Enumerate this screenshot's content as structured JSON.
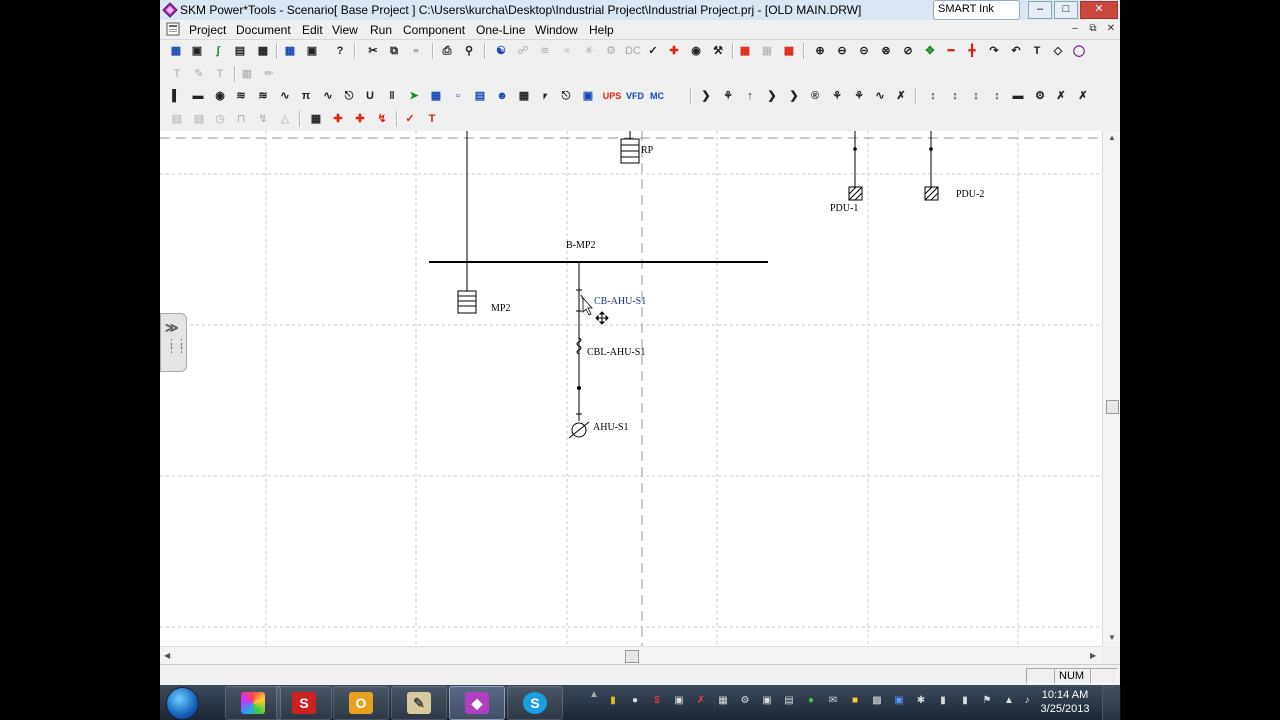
{
  "window": {
    "title": "SKM Power*Tools - Scenario[ Base Project ] C:\\Users\\kurcha\\Desktop\\Industrial Project\\Industrial Project.prj - [OLD MAIN.DRW]",
    "smart_ink_label": "SMART Ink",
    "minimize": "–",
    "maximize": "□",
    "close": "✕"
  },
  "menu": {
    "items": [
      "Project",
      "Document",
      "Edit",
      "View",
      "Run",
      "Component",
      "One-Line",
      "Window",
      "Help"
    ]
  },
  "one_line": {
    "buses": [
      {
        "id": "bus-b-mp2",
        "label": "B-MP2"
      }
    ],
    "components": [
      {
        "id": "panel-rp",
        "label": "RP",
        "type": "panel"
      },
      {
        "id": "pdu-1",
        "label": "PDU-1",
        "type": "pdu"
      },
      {
        "id": "pdu-2",
        "label": "PDU-2",
        "type": "pdu"
      },
      {
        "id": "panel-mp2",
        "label": "MP2",
        "type": "panel"
      },
      {
        "id": "breaker-cb-ahu-s1",
        "label": "CB-AHU-S1",
        "type": "breaker"
      },
      {
        "id": "cable-cbl-ahu-s1",
        "label": "CBL-AHU-S1",
        "type": "cable"
      },
      {
        "id": "motor-ahu-s1",
        "label": "AHU-S1",
        "type": "motor"
      }
    ]
  },
  "status": {
    "num": "NUM"
  },
  "taskbar": {
    "apps": [
      "internet-explorer",
      "color-app",
      "skm-app",
      "outlook",
      "notepad-app",
      "smart-notebook",
      "skype"
    ],
    "clock_time": "10:14 AM",
    "clock_date": "3/25/2013"
  },
  "colors": {
    "titlebar": "#dbe6f3",
    "canvas": "#ffffff",
    "grid_line": "#c8c8c8",
    "label_blue": "#1c2f8a",
    "taskbar": "#26303e"
  }
}
